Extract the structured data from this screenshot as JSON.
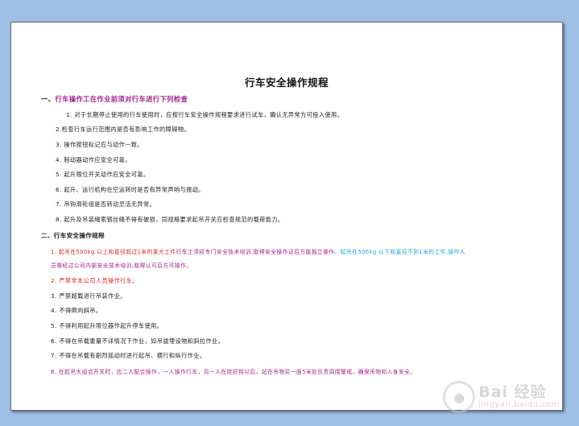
{
  "document": {
    "title": "行车安全操作规程",
    "section1": {
      "heading_num": "一、",
      "heading_text": "行车操作工在作业前须对行车进行下列检查",
      "items": [
        "1. 对于长期停止使用的行车使用时，应按行车安全操作规程要求进行试车，确认无异常方可投入使用。",
        "2.检查行车运行范围内是否有影响工作的障碍物。",
        "3. 操作按钮标记应与动作一致。",
        "4. 制动器动作应安全可靠。",
        "5. 起升限位开关动作应安全可靠。",
        "6. 起升、运行机构在空运转时是否有异常声响与振动。",
        "7. 吊钩滑轮组是否转动灵活无异常。",
        "8. 起升及吊装绳索钢丝绳不得有破损，同规格要求起吊开关应检查规范的载荷能力。"
      ]
    },
    "section2": {
      "heading_num": "二、",
      "heading_text": "行车安全操作规程",
      "item1_part_red": "1. 起吊在500kg 以上和直径超过1米的重大工件",
      "item1_part_magenta": "行车工须经专门安全技术培训,取得安全操作证后方能独立操作",
      "item1_part_cyan": "。起吊在500kg 以下和直径不到1米的工件,操作人",
      "item1_line2": "员需经过公司内部安全技术培训,取得认可后方可操作。",
      "item2": "2. 严禁非本公司人员操作行车。",
      "item3": "3.    严禁超载进行吊装作业。",
      "item4": "4.    不得倒向斜吊。",
      "item5": "5.    不得利用起升限位器作起升停车使用。",
      "item6": "6. 不得在吊载重量不详情况下作业，如吊拔埋设物和斜拉作业。",
      "item7": "7. 不得在吊载有剧烈摇动时进行起吊、横行和纵行作业。",
      "item8": "8.    在起吊大组合开关时，应二人配合操作，一人操作行车，另一人在拴好钩以后，站在吊物另一面5米处负责周围警戒，确保吊物和人身安全。"
    },
    "watermark": {
      "main": "Bai 经验",
      "sub": "jingyan.baidu.com"
    },
    "colors": {
      "background": "#9fbfe6",
      "magenta": "#a0258b",
      "red": "#d62a2a",
      "cyan": "#1fa9c9"
    }
  }
}
